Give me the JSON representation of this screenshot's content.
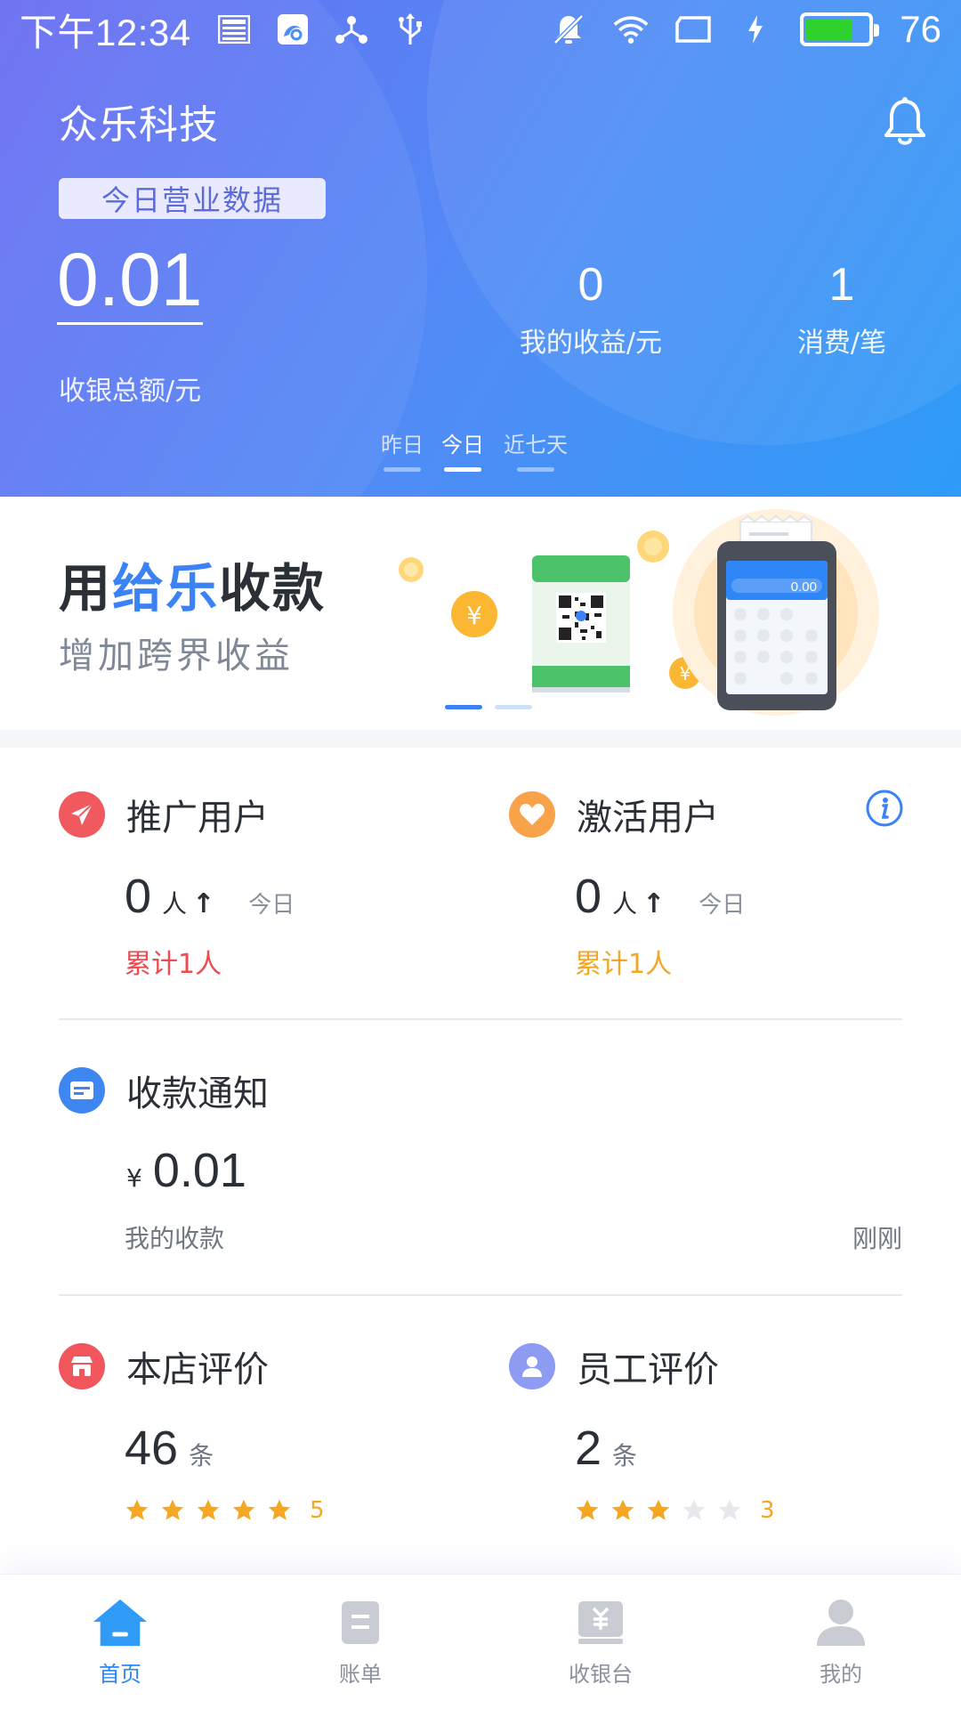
{
  "status_bar": {
    "time": "下午12:34",
    "battery_level": "76",
    "battery_fraction": 0.76,
    "battery_color": "#2fd12f"
  },
  "header": {
    "company": "众乐科技",
    "badge": "今日营业数据",
    "total_amount": "0.01",
    "total_label": "收银总额/元",
    "stats": [
      {
        "value": "0",
        "label": "我的收益/元"
      },
      {
        "value": "1",
        "label": "消费/笔"
      }
    ],
    "ranges": [
      "昨日",
      "今日",
      "近七天"
    ],
    "active_range": "今日"
  },
  "banner": {
    "title_prefix": "用",
    "title_highlight": "给乐",
    "title_suffix": "收款",
    "subtitle": "增加跨界收益",
    "pos_amount": "0.00",
    "active_slide": 1,
    "slide_count": 2
  },
  "promote": {
    "title": "推广用户",
    "count": "0",
    "unit": "人",
    "period": "今日",
    "cumulative": "累计1人",
    "color": "#f0494e"
  },
  "activate": {
    "title": "激活用户",
    "count": "0",
    "unit": "人",
    "period": "今日",
    "cumulative": "累计1人",
    "color": "#f5a623"
  },
  "payment_notice": {
    "title": "收款通知",
    "currency": "¥",
    "amount": "0.01",
    "label": "我的收款",
    "time": "刚刚"
  },
  "store_review": {
    "title": "本店评价",
    "count": "46",
    "unit": "条",
    "rating": "5",
    "stars_filled": 5
  },
  "staff_review": {
    "title": "员工评价",
    "count": "2",
    "unit": "条",
    "rating": "3",
    "stars_filled": 3
  },
  "tabs": [
    {
      "label": "首页",
      "icon": "home-icon",
      "active": true
    },
    {
      "label": "账单",
      "icon": "bill-icon",
      "active": false
    },
    {
      "label": "收银台",
      "icon": "cashier-icon",
      "active": false
    },
    {
      "label": "我的",
      "icon": "profile-icon",
      "active": false
    }
  ],
  "colors": {
    "accent": "#2f86f6",
    "star": "#f5a623",
    "star_empty": "#e6e8ec"
  }
}
